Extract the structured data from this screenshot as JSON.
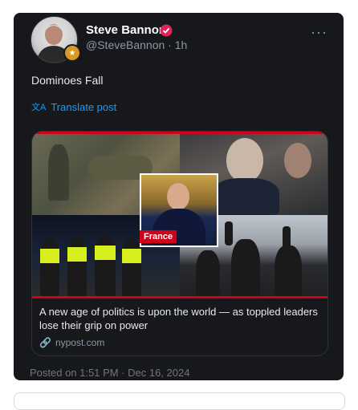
{
  "post": {
    "author_name": "Steve Bannon",
    "handle_time": "@SteveBannon · 1h",
    "text": "Dominoes Fall",
    "translate_label": "Translate post",
    "timestamp": "Posted on 1:51 PM · Dec 16, 2024"
  },
  "link_card": {
    "overlay_label": "France",
    "title": "A new age of politics is upon the world — as toppled leaders lose their grip on power",
    "domain": "nypost.com"
  },
  "icons": {
    "verified": "verified-badge-icon",
    "more": "more-options-icon",
    "translate": "translate-icon",
    "link": "link-icon"
  },
  "colors": {
    "card_background": "#16181c",
    "link_blue": "#1d9bf0",
    "verified_red": "#e0245e",
    "accent_red": "#d0021b"
  }
}
